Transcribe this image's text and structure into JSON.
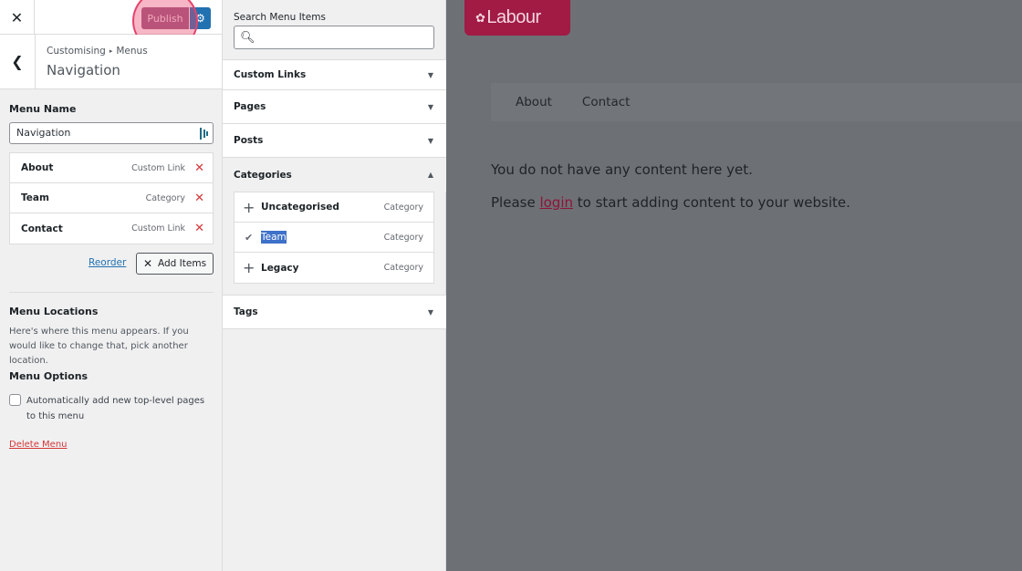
{
  "header": {
    "close_icon": "close-icon",
    "publish_label": "Publish",
    "settings_icon": "gear-icon"
  },
  "breadcrumb": {
    "parent": "Customising",
    "separator": "▸",
    "current": "Menus",
    "title": "Navigation"
  },
  "menu": {
    "name_label": "Menu Name",
    "name_value": "Navigation",
    "items": [
      {
        "title": "About",
        "type": "Custom Link"
      },
      {
        "title": "Team",
        "type": "Category"
      },
      {
        "title": "Contact",
        "type": "Custom Link"
      }
    ],
    "reorder_label": "Reorder",
    "add_items_label": "Add Items",
    "locations_title": "Menu Locations",
    "locations_desc": "Here's where this menu appears. If you would like to change that, pick another location.",
    "options_title": "Menu Options",
    "auto_add_label": "Automatically add new top-level pages to this menu",
    "auto_add_checked": false,
    "delete_label": "Delete Menu"
  },
  "available": {
    "search_label": "Search Menu Items",
    "search_value": "",
    "sections": {
      "custom_links": "Custom Links",
      "pages": "Pages",
      "posts": "Posts",
      "categories": "Categories",
      "tags": "Tags"
    },
    "categories": [
      {
        "title": "Uncategorised",
        "type": "Category",
        "added": false
      },
      {
        "title": "Team",
        "type": "Category",
        "added": true
      },
      {
        "title": "Legacy",
        "type": "Category",
        "added": false
      }
    ]
  },
  "preview": {
    "logo_text": "Labour",
    "nav": [
      "About",
      "Contact"
    ],
    "message_1": "You do not have any content here yet.",
    "message_2_before": "Please ",
    "message_2_link": "login",
    "message_2_after": " to start adding content to your website."
  },
  "colors": {
    "publish": "#9c5b82",
    "primary": "#2271b1",
    "danger": "#d63638",
    "brand": "#a11b45"
  }
}
